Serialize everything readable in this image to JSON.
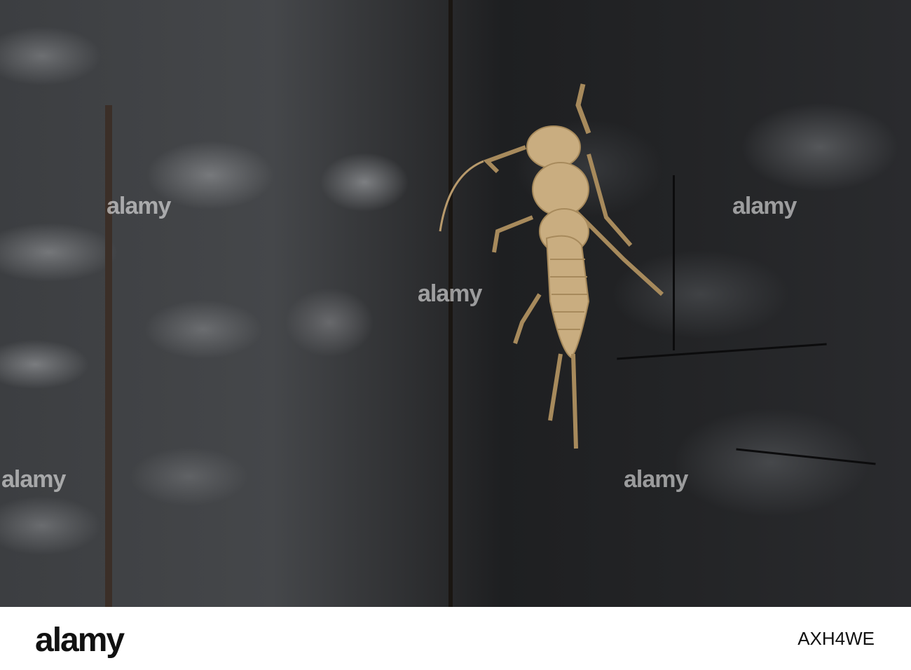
{
  "photo": {
    "subject": "stonefly-nymph-exuvia-on-charred-wood"
  },
  "watermark": {
    "text": "alamy"
  },
  "footer": {
    "logo": "alamy",
    "image_id": "AXH4WE"
  }
}
